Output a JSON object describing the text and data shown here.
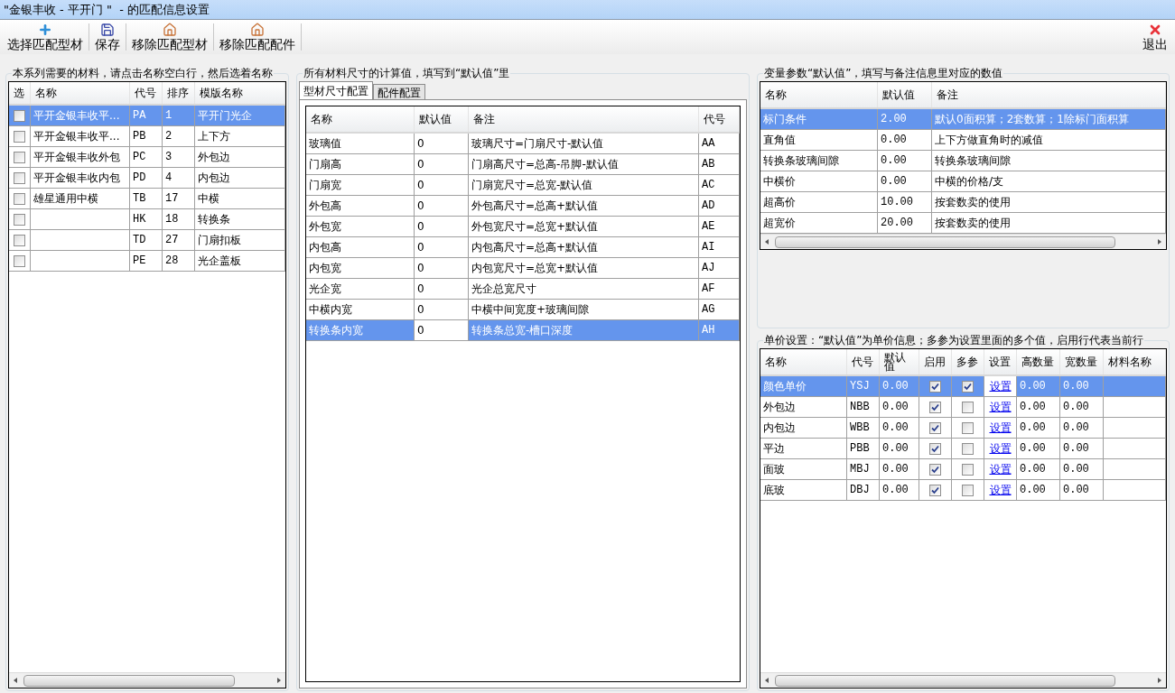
{
  "window": {
    "title": "\"金银丰收 - 平开门 \"  - 的匹配信息设置"
  },
  "toolbar": {
    "buttons": [
      {
        "label": "选择匹配型材",
        "kind": "add"
      },
      {
        "label": "保存",
        "kind": "save"
      },
      {
        "label": "移除匹配型材",
        "kind": "house"
      },
      {
        "label": "移除匹配配件",
        "kind": "house"
      }
    ],
    "exit": {
      "label": "退出",
      "kind": "close"
    }
  },
  "materials": {
    "title": "本系列需要的材料，请点击名称空白行，然后选着名称",
    "columns": [
      "选",
      "名称",
      "代号",
      "排序",
      "模版名称"
    ],
    "rows": [
      {
        "checked": false,
        "name": "平开金银丰收平...",
        "code": "PA",
        "order": "1",
        "template": "平开门光企",
        "selected": true
      },
      {
        "checked": false,
        "name": "平开金银丰收平...",
        "code": "PB",
        "order": "2",
        "template": "上下方",
        "selected": false
      },
      {
        "checked": false,
        "name": "平开金银丰收外包",
        "code": "PC",
        "order": "3",
        "template": "外包边",
        "selected": false
      },
      {
        "checked": false,
        "name": "平开金银丰收内包",
        "code": "PD",
        "order": "4",
        "template": "内包边",
        "selected": false
      },
      {
        "checked": false,
        "name": "雄星通用中横",
        "code": "TB",
        "order": "17",
        "template": "中横",
        "selected": false
      },
      {
        "checked": false,
        "code": "HK",
        "order": "18",
        "template": "转换条",
        "selected": false
      },
      {
        "checked": false,
        "code": "TD",
        "order": "27",
        "template": "门扇扣板",
        "selected": false
      },
      {
        "checked": false,
        "code": "PE",
        "order": "28",
        "template": "光企盖板",
        "selected": false
      }
    ]
  },
  "sizes": {
    "title": "所有材料尺寸的计算值，填写到“默认值”里",
    "tabs": [
      {
        "label": "型材尺寸配置",
        "selected": true
      },
      {
        "label": "配件配置",
        "selected": false
      }
    ],
    "columns": [
      "名称",
      "默认值",
      "备注",
      "代号"
    ],
    "rows": [
      {
        "name": "玻璃值",
        "value": "0",
        "note": "玻璃尺寸=门扇尺寸-默认值",
        "code": "AA",
        "selected": false
      },
      {
        "name": "门扇高",
        "value": "0",
        "note": "门扇高尺寸=总高-吊脚-默认值",
        "code": "AB",
        "selected": false
      },
      {
        "name": "门扇宽",
        "value": "0",
        "note": "门扇宽尺寸=总宽-默认值",
        "code": "AC",
        "selected": false
      },
      {
        "name": "外包高",
        "value": "0",
        "note": "外包高尺寸=总高+默认值",
        "code": "AD",
        "selected": false
      },
      {
        "name": "外包宽",
        "value": "0",
        "note": "外包宽尺寸=总宽+默认值",
        "code": "AE",
        "selected": false
      },
      {
        "name": "内包高",
        "value": "0",
        "note": "内包高尺寸=总高+默认值",
        "code": "AI",
        "selected": false
      },
      {
        "name": "内包宽",
        "value": "0",
        "note": "内包宽尺寸=总宽+默认值",
        "code": "AJ",
        "selected": false
      },
      {
        "name": "光企宽",
        "value": "0",
        "note": "光企总宽尺寸",
        "code": "AF",
        "selected": false
      },
      {
        "name": "中横内宽",
        "value": "0",
        "note": "中横中间宽度+玻璃间隙",
        "code": "AG",
        "selected": false
      },
      {
        "name": "转换条内宽",
        "value": "0",
        "note": "转换条总宽-槽口深度",
        "code": "AH",
        "selected": true
      }
    ]
  },
  "variables": {
    "title": "变量参数“默认值”，填写与备注信息里对应的数值",
    "columns": [
      "名称",
      "默认值",
      "备注"
    ],
    "rows": [
      {
        "name": "标门条件",
        "value": "2.00",
        "note": "默认0面积算；2套数算；1除标门面积算",
        "selected": true
      },
      {
        "name": "直角值",
        "value": "0.00",
        "note": "上下方做直角时的减值",
        "selected": false
      },
      {
        "name": "转换条玻璃间隙",
        "value": "0.00",
        "note": "转换条玻璃间隙",
        "selected": false
      },
      {
        "name": "中横价",
        "value": "0.00",
        "note": "中横的价格/支",
        "selected": false
      },
      {
        "name": "超高价",
        "value": "10.00",
        "note": "按套数卖的使用",
        "selected": false
      },
      {
        "name": "超宽价",
        "value": "20.00",
        "note": "按套数卖的使用",
        "selected": false
      }
    ]
  },
  "prices": {
    "title": "单价设置：“默认值”为单价信息；多参为设置里面的多个值，启用行代表当前行",
    "columns": [
      "名称",
      "代号",
      "默认值",
      "启用",
      "多参",
      "设置",
      "高数量",
      "宽数量",
      "材料名称"
    ],
    "rows": [
      {
        "name": "颜色单价",
        "code": "YSJ",
        "value": "0.00",
        "enabled": true,
        "multi": true,
        "setting": "设置",
        "height_qty": "0.00",
        "width_qty": "0.00",
        "selected": true
      },
      {
        "name": "外包边",
        "code": "NBB",
        "value": "0.00",
        "enabled": true,
        "multi": false,
        "setting": "设置",
        "height_qty": "0.00",
        "width_qty": "0.00",
        "selected": false
      },
      {
        "name": "内包边",
        "code": "WBB",
        "value": "0.00",
        "enabled": true,
        "multi": false,
        "setting": "设置",
        "height_qty": "0.00",
        "width_qty": "0.00",
        "selected": false
      },
      {
        "name": "平边",
        "code": "PBB",
        "value": "0.00",
        "enabled": true,
        "multi": false,
        "setting": "设置",
        "height_qty": "0.00",
        "width_qty": "0.00",
        "selected": false
      },
      {
        "name": "面玻",
        "code": "MBJ",
        "value": "0.00",
        "enabled": true,
        "multi": false,
        "setting": "设置",
        "height_qty": "0.00",
        "width_qty": "0.00",
        "selected": false
      },
      {
        "name": "底玻",
        "code": "DBJ",
        "value": "0.00",
        "enabled": true,
        "multi": false,
        "setting": "设置",
        "height_qty": "0.00",
        "width_qty": "0.00",
        "selected": false
      }
    ]
  }
}
